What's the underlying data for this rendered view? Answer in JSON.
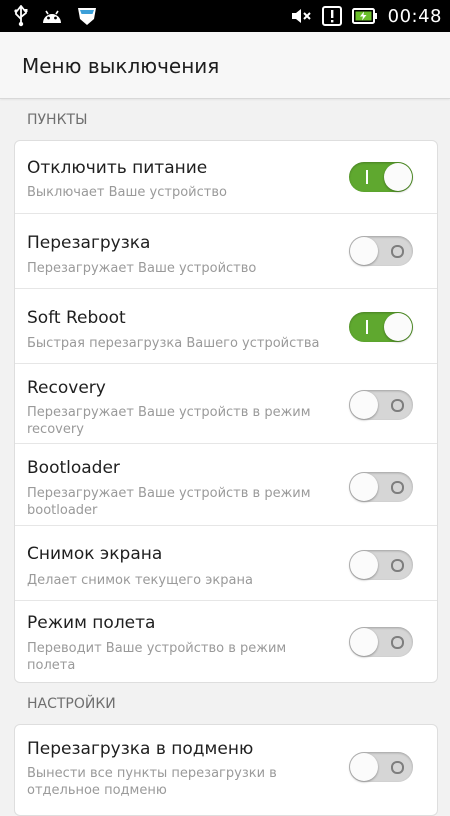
{
  "statusbar": {
    "time": "00:48",
    "icons": [
      "usb-icon",
      "android-icon",
      "shield-app-icon",
      "mute-icon",
      "alert-icon",
      "battery-charging-icon"
    ]
  },
  "header": {
    "title": "Меню выключения"
  },
  "sections": [
    {
      "title": "ПУНКТЫ"
    },
    {
      "title": "НАСТРОЙКИ"
    }
  ],
  "items": [
    {
      "title": "Отключить питание",
      "subtitle": "Выключает Ваше устройство",
      "enabled": true
    },
    {
      "title": "Перезагрузка",
      "subtitle": "Перезагружает Ваше устройство",
      "enabled": false
    },
    {
      "title": "Soft Reboot",
      "subtitle": "Быстрая перезагрузка Вашего устройства",
      "enabled": true
    },
    {
      "title": "Recovery",
      "subtitle": "Перезагружает Ваше устройств в режим recovery",
      "enabled": false
    },
    {
      "title": "Bootloader",
      "subtitle": "Перезагружает Ваше устройств в режим bootloader",
      "enabled": false
    },
    {
      "title": "Снимок экрана",
      "subtitle": "Делает снимок текущего экрана",
      "enabled": false
    },
    {
      "title": "Режим полета",
      "subtitle": "Переводит Ваше устройство в режим полета",
      "enabled": false
    }
  ],
  "settings_items": [
    {
      "title": "Перезагрузка в подменю",
      "subtitle": "Вынести все пункты перезагрузки в отдельное подменю",
      "enabled": false
    }
  ],
  "colors": {
    "switch_on": "#5fa82f",
    "switch_off": "#d6d6d6"
  }
}
